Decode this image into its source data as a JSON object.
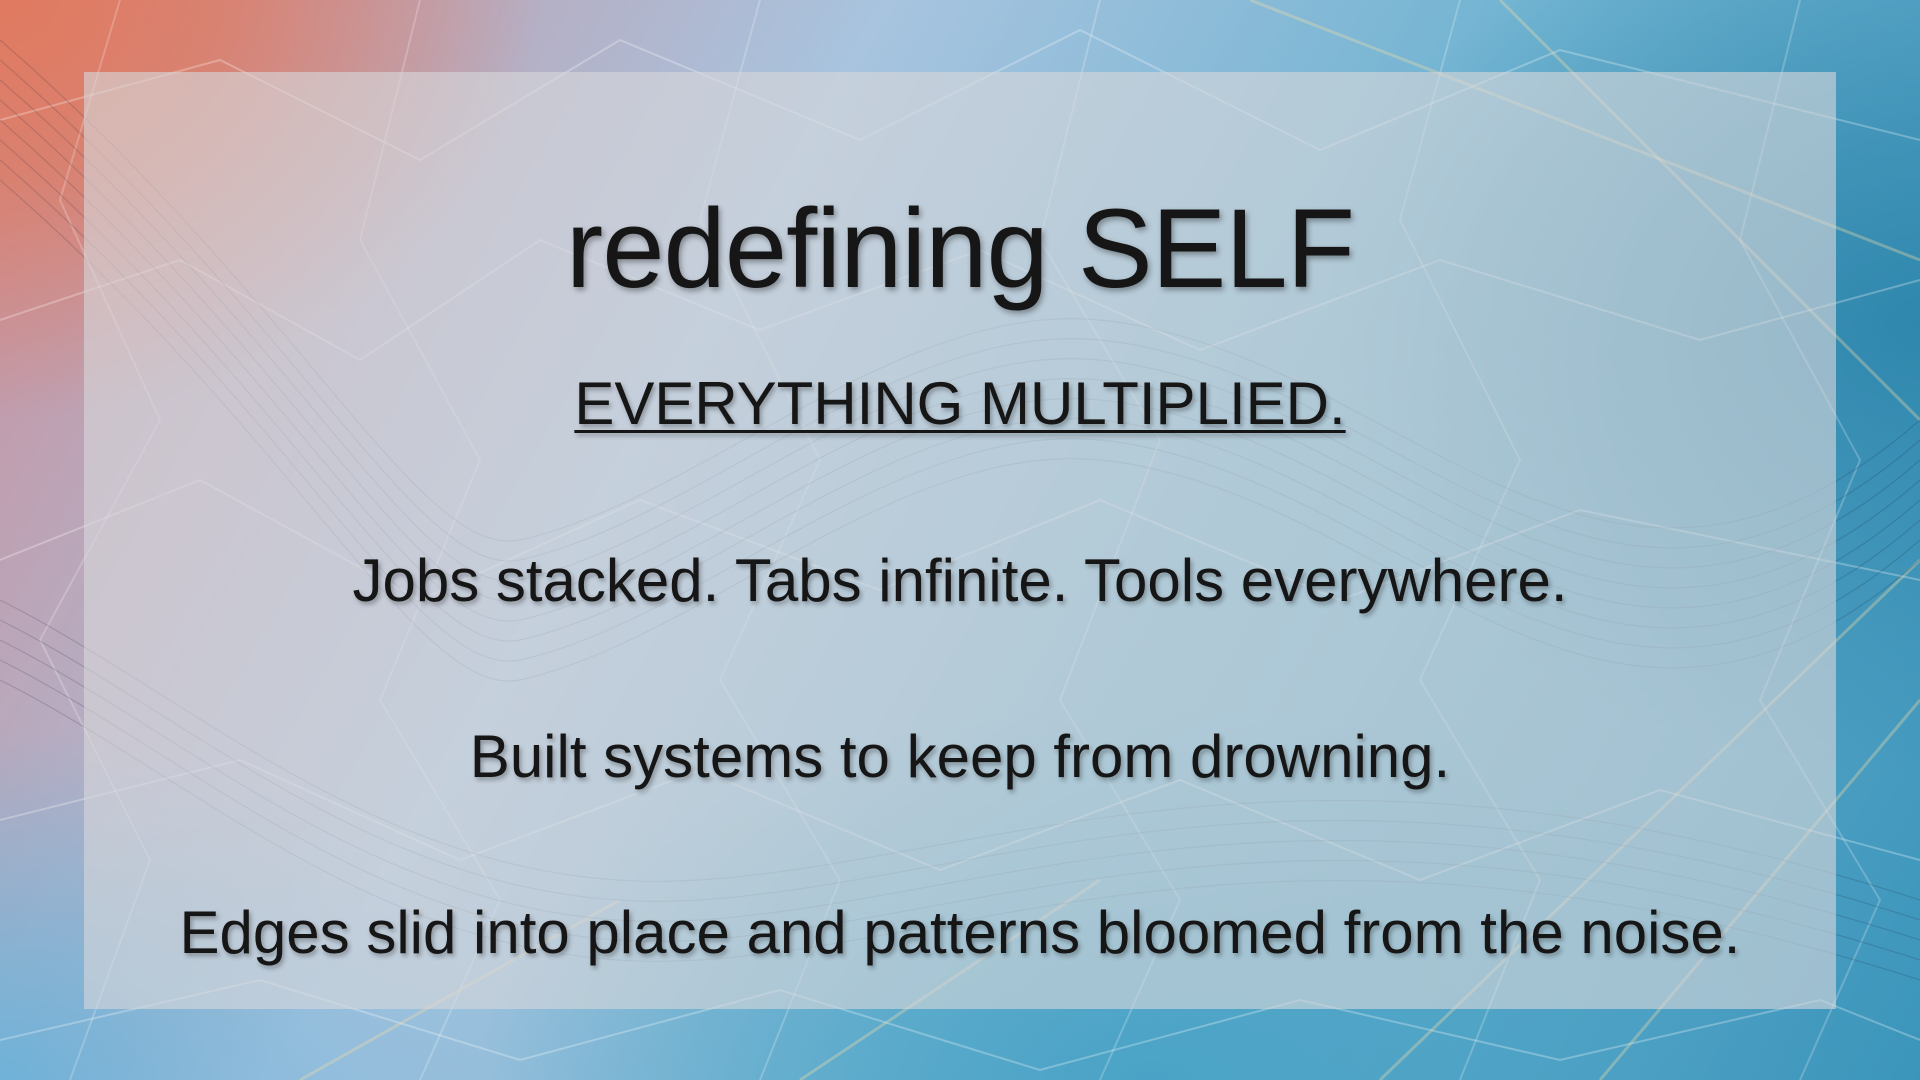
{
  "slide": {
    "title": "redefining SELF",
    "subtitle": "EVERYTHING MULTIPLIED.",
    "lines": [
      "Jobs stacked. Tabs infinite. Tools everywhere.",
      "Built systems to keep from drowning.",
      "Edges slid into place and patterns bloomed from the noise."
    ]
  },
  "colors": {
    "text": "#161616",
    "panel": "#d7d7da",
    "accent_warm": "#e07a5f",
    "accent_cool": "#3b95bb"
  }
}
